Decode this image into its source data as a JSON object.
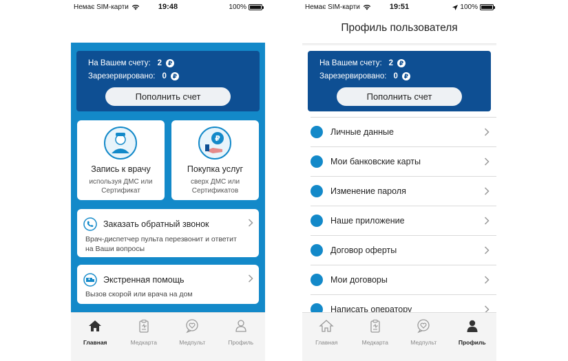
{
  "status_left": {
    "carrier": "Немає SIM-карти",
    "time": "19:48",
    "battery": "100%"
  },
  "status_right": {
    "carrier": "Немає SIM-карти",
    "time": "19:51",
    "battery": "100%"
  },
  "balance": {
    "account_label": "На Вашем счету:",
    "account_value": "2",
    "reserved_label": "Зарезервировано:",
    "reserved_value": "0",
    "currency_symbol": "₽",
    "topup_label": "Пополнить счет"
  },
  "home": {
    "tiles": [
      {
        "title": "Запись к врачу",
        "subtitle": "используя ДМС или Сертификат",
        "icon": "doctor-icon"
      },
      {
        "title": "Покупка услуг",
        "subtitle": "сверх ДМС или Сертификатов",
        "icon": "ruble-hand-icon"
      }
    ],
    "callback": {
      "title": "Заказать обратный звонок",
      "subtitle": "Врач-диспетчер пульта перезвонит и ответит на Ваши вопросы",
      "icon": "phone-call-icon"
    },
    "emergency": {
      "title": "Экстренная помощь",
      "subtitle": "Вызов скорой или врача на дом",
      "icon": "ambulance-icon"
    }
  },
  "profile": {
    "title": "Профиль пользователя",
    "menu": [
      {
        "label": "Личные данные",
        "icon": "id-card-icon"
      },
      {
        "label": "Мои банковские карты",
        "icon": "bank-card-icon"
      },
      {
        "label": "Изменение пароля",
        "icon": "key-icon"
      },
      {
        "label": "Наше приложение",
        "icon": "phone-icon"
      },
      {
        "label": "Договор оферты",
        "icon": "document-icon"
      },
      {
        "label": "Мои договоры",
        "icon": "folder-icon"
      },
      {
        "label": "Написать оператору",
        "icon": "chat-icon"
      }
    ]
  },
  "tabs": [
    {
      "label": "Главная",
      "icon": "home-icon"
    },
    {
      "label": "Медкарта",
      "icon": "clipboard-icon"
    },
    {
      "label": "Медпульт",
      "icon": "heart-chat-icon"
    },
    {
      "label": "Профиль",
      "icon": "user-icon"
    }
  ],
  "colors": {
    "primary_blue": "#1389c9",
    "dark_blue": "#0e4f93",
    "tab_bg": "#f4f4f4"
  }
}
